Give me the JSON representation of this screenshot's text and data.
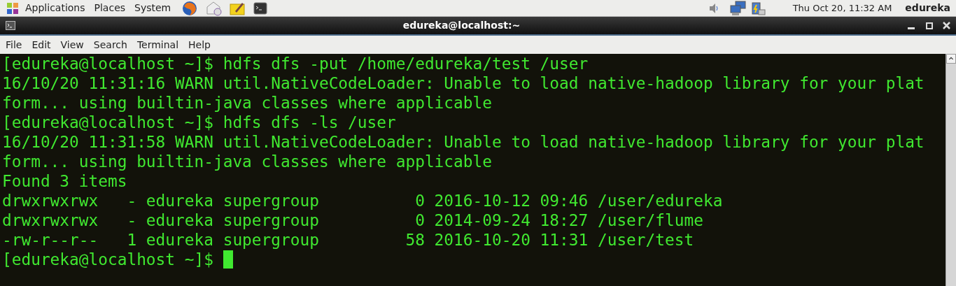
{
  "top_panel": {
    "menus": [
      "Applications",
      "Places",
      "System"
    ],
    "clock": "Thu Oct 20, 11:32 AM",
    "user": "edureka"
  },
  "window": {
    "title": "edureka@localhost:~"
  },
  "menu_bar": [
    "File",
    "Edit",
    "View",
    "Search",
    "Terminal",
    "Help"
  ],
  "terminal": {
    "lines": [
      "[edureka@localhost ~]$ hdfs dfs -put /home/edureka/test /user",
      "16/10/20 11:31:16 WARN util.NativeCodeLoader: Unable to load native-hadoop library for your plat",
      "form... using builtin-java classes where applicable",
      "[edureka@localhost ~]$ hdfs dfs -ls /user",
      "16/10/20 11:31:58 WARN util.NativeCodeLoader: Unable to load native-hadoop library for your plat",
      "form... using builtin-java classes where applicable",
      "Found 3 items",
      "drwxrwxrwx   - edureka supergroup          0 2016-10-12 09:46 /user/edureka",
      "drwxrwxrwx   - edureka supergroup          0 2014-09-24 18:27 /user/flume",
      "-rw-r--r--   1 edureka supergroup         58 2016-10-20 11:31 /user/test",
      "[edureka@localhost ~]$ "
    ]
  }
}
